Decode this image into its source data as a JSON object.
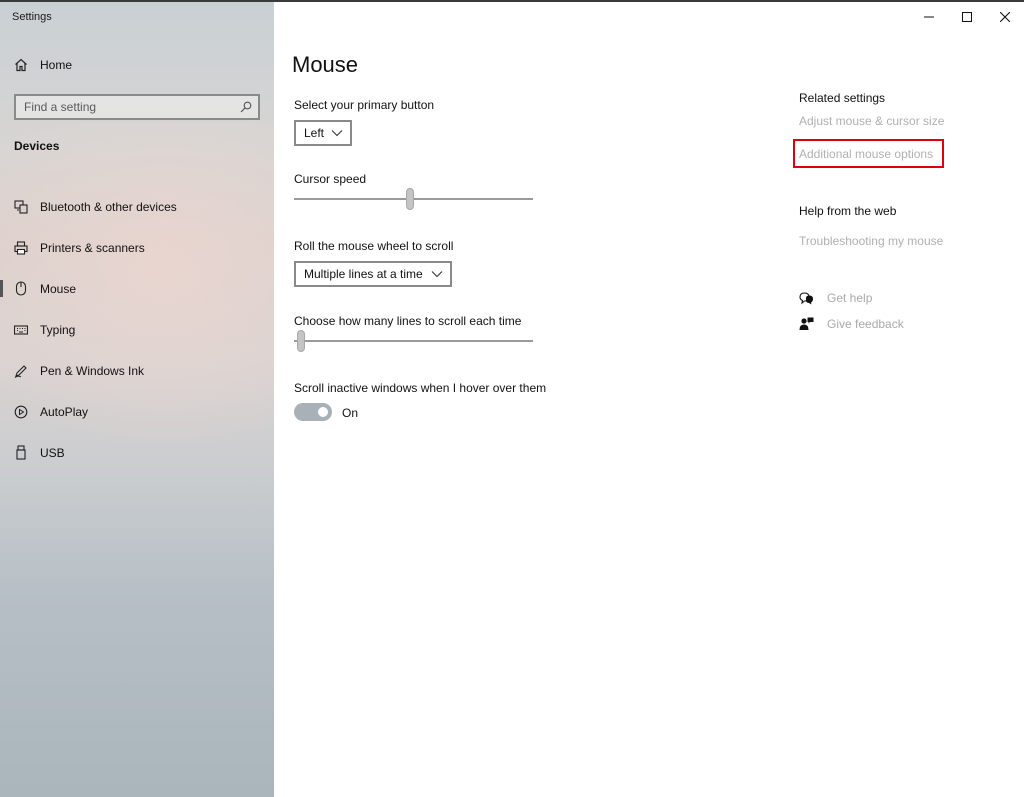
{
  "window": {
    "title": "Settings"
  },
  "sidebar": {
    "home_label": "Home",
    "search_placeholder": "Find a setting",
    "section_title": "Devices",
    "items": [
      {
        "label": "Bluetooth & other devices",
        "icon": "bluetooth-devices-icon"
      },
      {
        "label": "Printers & scanners",
        "icon": "printer-icon"
      },
      {
        "label": "Mouse",
        "icon": "mouse-icon",
        "active": true
      },
      {
        "label": "Typing",
        "icon": "keyboard-icon"
      },
      {
        "label": "Pen & Windows Ink",
        "icon": "pen-icon"
      },
      {
        "label": "AutoPlay",
        "icon": "autoplay-icon"
      },
      {
        "label": "USB",
        "icon": "usb-icon"
      }
    ]
  },
  "main": {
    "title": "Mouse",
    "primary_button": {
      "label": "Select your primary button",
      "value": "Left"
    },
    "cursor_speed": {
      "label": "Cursor speed",
      "level_fraction": 0.47
    },
    "scroll_wheel": {
      "label": "Roll the mouse wheel to scroll",
      "value": "Multiple lines at a time"
    },
    "scroll_lines": {
      "label": "Choose how many lines to scroll each time",
      "level_fraction": 0.0
    },
    "inactive_scroll": {
      "label": "Scroll inactive windows when I hover over them",
      "state": "On"
    }
  },
  "related": {
    "heading": "Related settings",
    "links": [
      "Adjust mouse & cursor size",
      "Additional mouse options"
    ],
    "help_heading": "Help from the web",
    "help_links": [
      "Troubleshooting my mouse"
    ],
    "get_help": "Get help",
    "give_feedback": "Give feedback",
    "highlight_color": "#e0000b"
  }
}
